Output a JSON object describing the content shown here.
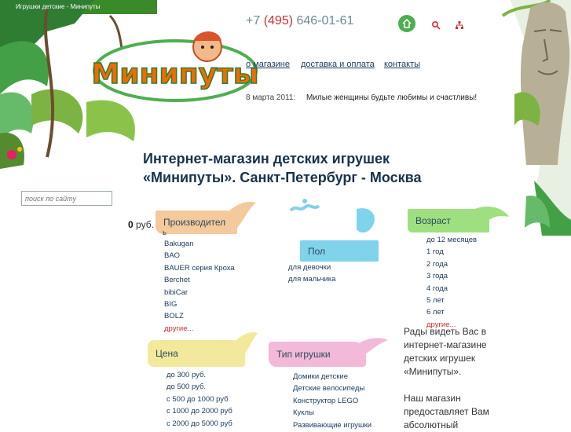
{
  "page": {
    "tab_title": "Игрушки детские - Минипуты"
  },
  "logo": {
    "text": "Минипуты"
  },
  "header": {
    "phone_prefix": "+7 ",
    "phone_code": "(495)",
    "phone_number": " 646-01-61",
    "icons": [
      "home-icon",
      "search-icon",
      "sitemap-icon"
    ]
  },
  "nav": {
    "about": "о магазине",
    "delivery": "доставка и оплата",
    "contacts": "контакты"
  },
  "news": {
    "date": "8 марта 2011:",
    "text": "Милые женщины будьте любимы и счастливы!"
  },
  "headline": {
    "line1": "Интернет-магазин детских игрушек",
    "line2": "«Минипуты». Санкт-Петербург - Москва"
  },
  "search": {
    "placeholder": "поиск по сайту"
  },
  "cart": {
    "amount": "0",
    "currency": "руб."
  },
  "filters": {
    "brand": {
      "label": "Производител",
      "label_overflow": "ь",
      "items": [
        "Bakugan",
        "BAO",
        "BAUER серия Кроха",
        "Berchet",
        "bibiCar",
        "BIG",
        "BOLZ"
      ],
      "more": "другие..."
    },
    "gender": {
      "label": "Пол",
      "items": [
        "для девочки",
        "для мальчика"
      ]
    },
    "age": {
      "label": "Возраст",
      "items": [
        "до 12 месяцев",
        "1 год",
        "2 года",
        "3 года",
        "4 года",
        "5 лет",
        "6 лет"
      ],
      "more": "другие..."
    },
    "price": {
      "label": "Цена",
      "items": [
        "до 300 руб.",
        "до 500 руб.",
        "с 500 до 1000 руб",
        "с 1000 до 2000 руб",
        "с 2000 до 5000 руб"
      ]
    },
    "type": {
      "label": "Тип игрушки",
      "items": [
        "Домики детские",
        "Детские велосипеды",
        "Конструктор LEGO",
        "Куклы",
        "Развивающие игрушки"
      ]
    }
  },
  "welcome": {
    "p1": "Рады видеть Вас в интернет-магазине детских игрушек «Минипуты».",
    "p2": "Наш магазин предоставляет Вам абсолютный"
  },
  "colors": {
    "accent_red": "#d32f2f",
    "link_blue": "#1a3a5c",
    "leaf_green": "#4caf50"
  }
}
